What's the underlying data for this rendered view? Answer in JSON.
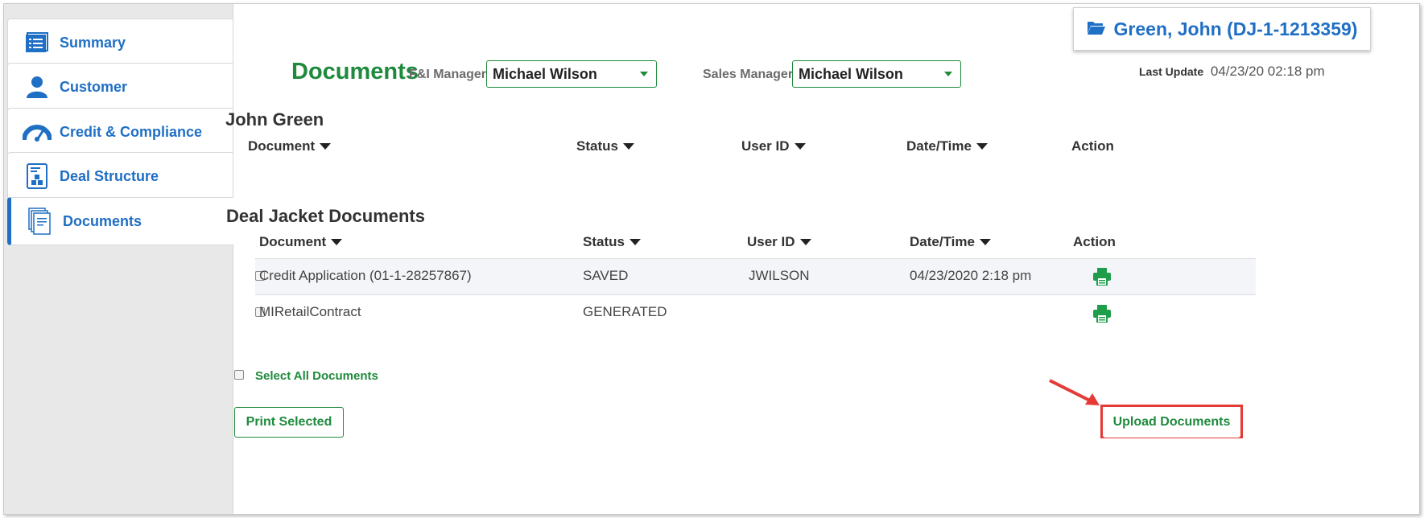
{
  "sidebar": {
    "items": [
      {
        "label": "Summary",
        "icon": "summary-list-icon"
      },
      {
        "label": "Customer",
        "icon": "person-icon"
      },
      {
        "label": "Credit & Compliance",
        "icon": "gauge-icon"
      },
      {
        "label": "Deal Structure",
        "icon": "deal-structure-icon"
      },
      {
        "label": "Documents",
        "icon": "documents-icon",
        "active": true
      }
    ]
  },
  "header": {
    "deal_label": "Green, John (DJ-1-1213359)",
    "deal_icon": "folder-open-icon",
    "page_title": "Documents",
    "fi_manager_label": "F&I Manager",
    "fi_manager_value": "Michael Wilson",
    "sales_manager_label": "Sales Manager",
    "sales_manager_value": "Michael Wilson",
    "last_update_label": "Last Update",
    "last_update_value": "04/23/20 02:18 pm"
  },
  "customer_docs": {
    "title": "John Green",
    "columns": [
      "Document",
      "Status",
      "User ID",
      "Date/Time",
      "Action"
    ]
  },
  "deal_jacket_docs": {
    "title": "Deal Jacket Documents",
    "columns": [
      "Document",
      "Status",
      "User ID",
      "Date/Time",
      "Action"
    ],
    "rows": [
      {
        "document": "Credit Application (01-1-28257867)",
        "status": "SAVED",
        "user_id": "JWILSON",
        "datetime": "04/23/2020 2:18 pm"
      },
      {
        "document": "MIRetailContract",
        "status": "GENERATED",
        "user_id": "",
        "datetime": ""
      }
    ]
  },
  "footer": {
    "select_all_label": "Select All Documents",
    "print_selected_label": "Print Selected",
    "upload_label": "Upload Documents"
  },
  "colors": {
    "brand_blue": "#1f6fc5",
    "brand_green": "#1e8a3c",
    "highlight_red": "#e53935"
  }
}
